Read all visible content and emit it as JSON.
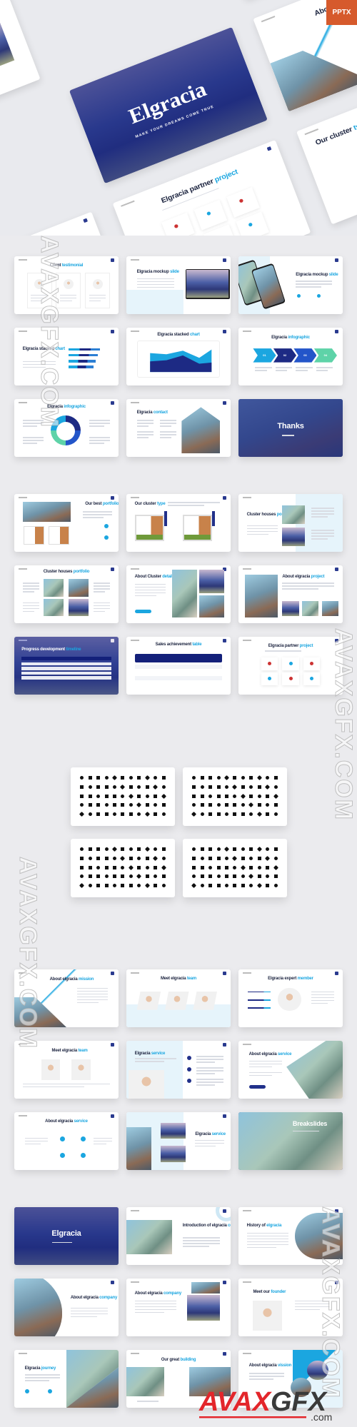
{
  "badge": "PPTX",
  "colors": {
    "navy": "#21308a",
    "accent": "#1ba6e0",
    "background": "#ebebee",
    "badge": "#d65a2c",
    "watermark_red": "#e3262b"
  },
  "watermark": {
    "text": "AVAXGFX.COM",
    "logo": "AVAXGFX",
    "logo_suffix": ".com"
  },
  "hero": {
    "cover": {
      "title": "Elgracia",
      "subtitle": "MAKE YOUR DREAMS COME TRUE"
    },
    "slides": [
      {
        "plain": "About elgracia ",
        "accent": "company",
        "kind": "photo-right"
      },
      {
        "plain": "",
        "accent": "",
        "kind": "steps"
      },
      {
        "plain": "History of ",
        "accent": "elgracia",
        "kind": "photo-circle"
      },
      {
        "plain": "Elgracia ",
        "accent": "service",
        "kind": "photo-left"
      },
      {
        "plain": "About elgracia ",
        "accent": "mission",
        "kind": "photo-diag"
      },
      {
        "plain": "About elgracia ",
        "accent": "service",
        "kind": "service4"
      },
      {
        "plain": "Elgracia partner ",
        "accent": "project",
        "kind": "partners"
      },
      {
        "plain": "Our cluster ",
        "accent": "type",
        "kind": "floorplan"
      }
    ]
  },
  "sections": [
    {
      "slides": [
        {
          "plain": "Client ",
          "accent": "testimonial",
          "kind": "people3"
        },
        {
          "plain": "Elgracia mockup ",
          "accent": "slide",
          "kind": "laptop"
        },
        {
          "plain": "Elgracia mockup ",
          "accent": "slide",
          "kind": "phones"
        },
        {
          "plain": "Elgracia stacked ",
          "accent": "chart",
          "kind": "bars"
        },
        {
          "plain": "Elgracia stacked ",
          "accent": "chart",
          "kind": "area"
        },
        {
          "plain": "Elgracia ",
          "accent": "infographic",
          "kind": "arrows",
          "labels": [
            "01",
            "02",
            "03",
            "04"
          ]
        },
        {
          "plain": "Elgracia ",
          "accent": "infographic",
          "kind": "donut"
        },
        {
          "plain": "Elgracia ",
          "accent": "contact",
          "kind": "contact"
        },
        {
          "plain": "Thanks",
          "accent": "",
          "kind": "dark-photo"
        }
      ]
    },
    {
      "slides": [
        {
          "plain": "Our best ",
          "accent": "portfolio",
          "kind": "portfolio"
        },
        {
          "plain": "Our cluster ",
          "accent": "type",
          "kind": "floorplan2"
        },
        {
          "plain": "Cluster houses ",
          "accent": "portfolio",
          "kind": "cluster"
        },
        {
          "plain": "Cluster houses ",
          "accent": "portfolio",
          "kind": "cluster4"
        },
        {
          "plain": "About Cluster ",
          "accent": "details",
          "kind": "details"
        },
        {
          "plain": "About elgracia ",
          "accent": "project",
          "kind": "project"
        },
        {
          "plain": "Progress development ",
          "accent": "timeline",
          "kind": "timeline"
        },
        {
          "plain": "Sales achievement ",
          "accent": "table",
          "kind": "table"
        },
        {
          "plain": "Elgracia partner ",
          "accent": "project",
          "kind": "partners"
        }
      ]
    },
    {
      "slides": [
        {
          "plain": "About elgracia ",
          "accent": "mission",
          "kind": "photo-diag"
        },
        {
          "plain": "Meet elgracia ",
          "accent": "team",
          "kind": "team3"
        },
        {
          "plain": "Elgracia expert ",
          "accent": "member",
          "kind": "expert"
        },
        {
          "plain": "Meet elgracia ",
          "accent": "team",
          "kind": "team2"
        },
        {
          "plain": "Elgracia ",
          "accent": "service",
          "kind": "worker"
        },
        {
          "plain": "About elgracia ",
          "accent": "service",
          "kind": "bld-right"
        },
        {
          "plain": "About elgracia ",
          "accent": "service",
          "kind": "service4"
        },
        {
          "plain": "Elgracia ",
          "accent": "service",
          "kind": "service-photos"
        },
        {
          "plain": "Breakslides",
          "accent": "",
          "kind": "break"
        }
      ]
    },
    {
      "slides": [
        {
          "plain": "Elgracia",
          "accent": "",
          "kind": "cover"
        },
        {
          "plain": "Introduction of elgracia ",
          "accent": "company",
          "kind": "photo-left"
        },
        {
          "plain": "History of ",
          "accent": "elgracia",
          "kind": "photo-circle"
        },
        {
          "plain": "About elgracia ",
          "accent": "company",
          "kind": "curve-left"
        },
        {
          "plain": "About elgracia ",
          "accent": "company",
          "kind": "photo-right"
        },
        {
          "plain": "Meet our ",
          "accent": "founder",
          "kind": "founder"
        },
        {
          "plain": "Elgracia ",
          "accent": "journey",
          "kind": "journey"
        },
        {
          "plain": "Our great ",
          "accent": "building",
          "kind": "building"
        },
        {
          "plain": "About elgracia ",
          "accent": "vission",
          "kind": "vision"
        }
      ]
    }
  ]
}
